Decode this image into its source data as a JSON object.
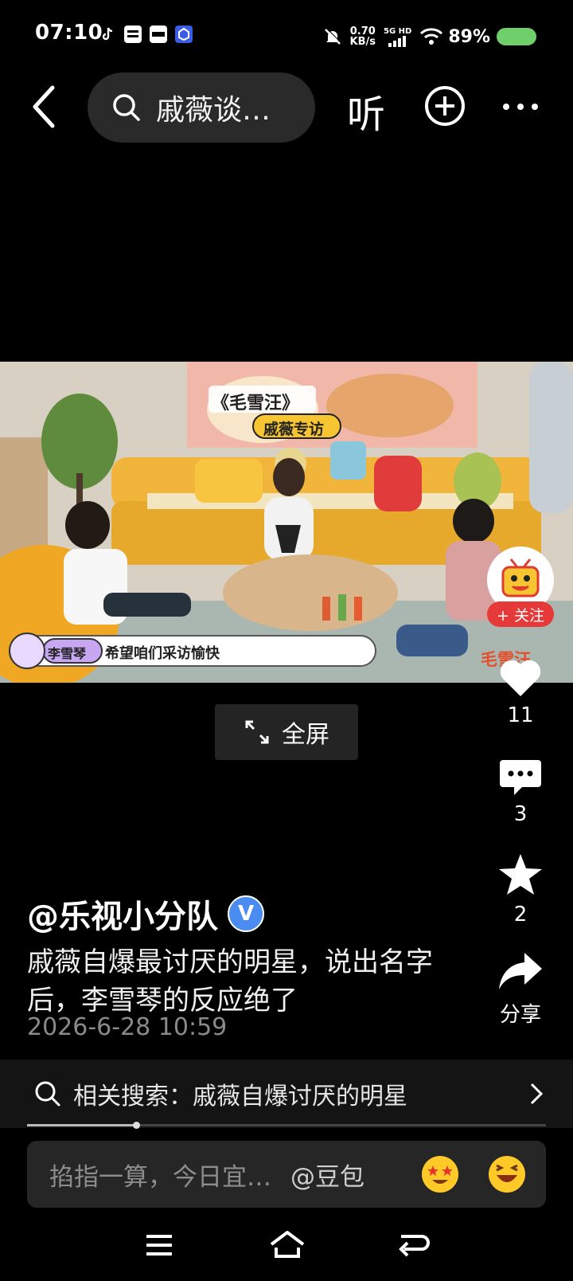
{
  "status_bar": {
    "time": "07:10",
    "net_speed_value": "0.70",
    "net_speed_unit": "KB/s",
    "network_label": "5G HD",
    "battery_percent": "89%"
  },
  "top_nav": {
    "search_text": "戚薇谈…",
    "listen_label": "听"
  },
  "video": {
    "title_card": "《毛雪汪》",
    "subtitle_card": "戚薇专访",
    "speaker_name": "李雪琴",
    "speaker_caption": "希望咱们采访愉快",
    "watermark": "毛雪汪",
    "fullscreen_label": "全屏"
  },
  "rail": {
    "follow_label": "+ 关注",
    "likes": "11",
    "comments": "3",
    "favorites": "2",
    "share_label": "分享"
  },
  "post": {
    "author": "@乐视小分队",
    "verified_badge": "V",
    "description": "戚薇自爆最讨厌的明星，说出名字后，李雪琴的反应绝了",
    "date": "2026-6-28 10:59",
    "related_search": "相关搜索：戚薇自爆讨厌的明星",
    "progress_fraction": 0.21
  },
  "comment": {
    "placeholder": "掐指一算，今日宜…",
    "mention": "@豆包"
  },
  "colors": {
    "accent_red": "#e63a3a",
    "battery_green": "#6fcf6a",
    "verified_blue": "#4a8cf0"
  }
}
